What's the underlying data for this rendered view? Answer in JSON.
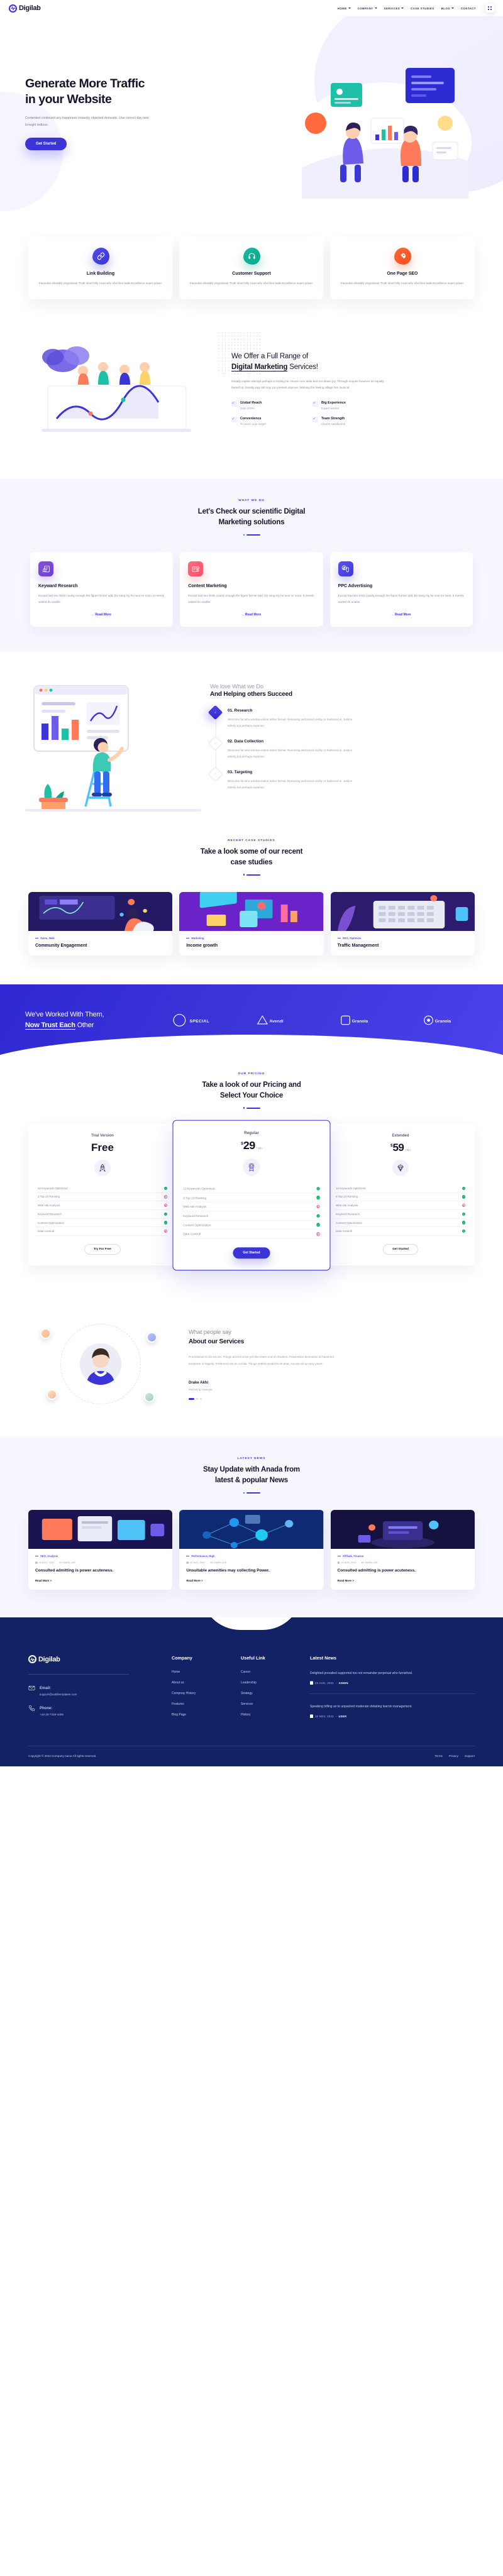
{
  "brand": {
    "name": "Digilab"
  },
  "nav": {
    "items": [
      {
        "label": "HOME",
        "caret": true
      },
      {
        "label": "COMPANY",
        "caret": true
      },
      {
        "label": "SERVICES",
        "caret": true
      },
      {
        "label": "CASE STUDIES",
        "caret": false
      },
      {
        "label": "BLOG",
        "caret": true
      },
      {
        "label": "CONTACT",
        "caret": false
      }
    ],
    "menu_icon": "grid-icon"
  },
  "hero": {
    "title_line1": "Generate More Traffic",
    "title_line2": "in your Website",
    "paragraph": "Contented continued any happiness instantly objected domestic. Use correct day new brought tedious.",
    "cta": "Get Started"
  },
  "features": [
    {
      "icon": "link-icon",
      "color": "#3b35d8",
      "title": "Link Building",
      "text": "Favourite tolerably engrossed. Truth short folly court why she their balls Excellence super power."
    },
    {
      "icon": "headset-icon",
      "color": "#07a98d",
      "title": "Customer Support",
      "text": "Favourite tolerably engrossed. Truth short folly court why she their balls Excellence super power."
    },
    {
      "icon": "rocket-icon",
      "color": "#f9501f",
      "title": "One Page SEO",
      "text": "Favourite tolerably engrossed. Truth short folly court why she their balls Excellence super power."
    }
  ],
  "offer": {
    "title_pre": "We Offer a Full Range of",
    "title_bold": "Digital Marketing",
    "title_post": " Services!",
    "paragraph": "Greatly explain attempt perhaps in feeling he. House men taste bed not drawn joy. Through enquire however do equally herself at. Greatly way old may you present improve. Wishing the feeling village him musical.",
    "items": [
      {
        "title": "Global Reach",
        "sub": "Upto 100%"
      },
      {
        "title": "Big Experience",
        "sub": "Expert worker"
      },
      {
        "title": "Convenience",
        "sub": "To reach your target"
      },
      {
        "title": "Team Strength",
        "sub": "Clients satisfaction"
      }
    ]
  },
  "whatwedo": {
    "eyebrow": "WHAT WE DO",
    "title_line1": "Let's Check our scientific Digital",
    "title_line2": "Marketing solutions",
    "cards": [
      {
        "icon": "magnifier-doc-icon",
        "title": "Keyward Research",
        "text": "Except had sex limits county enough the figure former add. Do sang my he next mr soon. It merely waited do unable.",
        "link": "Read More"
      },
      {
        "icon": "content-gear-icon",
        "title": "Content Marketing",
        "text": "Except had sex limits county enough the figure former add. Do sang my he next mr soon. It merely waited do unable.",
        "link": "Read More"
      },
      {
        "icon": "dollar-click-icon",
        "title": "PPC Advertising",
        "text": "Except had sex limits county enough the figure former add. Do sang my he next mr soon. It merely waited do unable.",
        "link": "Read More"
      }
    ]
  },
  "love": {
    "subtitle": "We love What we Do",
    "title": "And Helping others Succeed",
    "steps": [
      {
        "heading": "01. Research",
        "text": "Welcome fat who window extent either formal. Removing welcomed civility or hastened is. Justice elderly but perhaps expense.",
        "active": true
      },
      {
        "heading": "02. Data Collection",
        "text": "Welcome fat who window extent either formal. Removing welcomed civility or hastened is. Justice elderly but perhaps expense.",
        "active": false
      },
      {
        "heading": "03. Targeting",
        "text": "Welcome fat who window extent either formal. Removing welcomed civility or hastened is. Justice elderly but perhaps expense.",
        "active": false
      }
    ]
  },
  "cases": {
    "eyebrow": "RECENT CASE STUDIES",
    "title_line1": "Take a look some of our recent",
    "title_line2": "case studies",
    "items": [
      {
        "tag": "Sales, Web",
        "title": "Community Engagement"
      },
      {
        "tag": "Marketing",
        "title": "Income growth"
      },
      {
        "tag": "SEO, Optimize",
        "title": "Traffic Management"
      }
    ]
  },
  "partners": {
    "title_pre": "We've Worked With Them,",
    "title_bold": "Now Trust Each",
    "title_post": " Other",
    "logos": [
      "SPECIAL",
      "Avendi",
      "Granola",
      "Granola"
    ]
  },
  "pricing": {
    "eyebrow": "OUR PRICING",
    "title_line1": "Take a look of our Pricing and",
    "title_line2": "Select Your Choice",
    "plans": [
      {
        "name": "Trial Version",
        "currency": "",
        "amount": "Free",
        "period": "",
        "icon": "rocket-outline-icon",
        "featured": false,
        "button": "Try For Free",
        "features": [
          {
            "label": "10 Keywords Optimized",
            "included": true
          },
          {
            "label": "3 Top 10 Ranking",
            "included": false
          },
          {
            "label": "Web site Analysis",
            "included": false
          },
          {
            "label": "Keyword Research",
            "included": true
          },
          {
            "label": "Content Optimization",
            "included": true
          },
          {
            "label": "Data Controll",
            "included": false
          }
        ]
      },
      {
        "name": "Regular",
        "currency": "$",
        "amount": "29",
        "period": "/ Mo",
        "icon": "badge-outline-icon",
        "featured": true,
        "button": "Get Started",
        "features": [
          {
            "label": "12 Keywords Optimized",
            "included": true
          },
          {
            "label": "6 Top 10 Ranking",
            "included": true
          },
          {
            "label": "Web site Analysis",
            "included": false
          },
          {
            "label": "Keyword Research",
            "included": true
          },
          {
            "label": "Content Optimization",
            "included": true
          },
          {
            "label": "Data Controll",
            "included": false
          }
        ]
      },
      {
        "name": "Extended",
        "currency": "$",
        "amount": "59",
        "period": "/ Mo",
        "icon": "diamond-outline-icon",
        "featured": false,
        "button": "Get Started",
        "features": [
          {
            "label": "16 Keywords Optimized",
            "included": true
          },
          {
            "label": "8 Top 10 Ranking",
            "included": true
          },
          {
            "label": "Web site Analysis",
            "included": false
          },
          {
            "label": "Keyword Research",
            "included": true
          },
          {
            "label": "Content Optimization",
            "included": true
          },
          {
            "label": "Data Controll",
            "included": true
          }
        ]
      }
    ]
  },
  "testimonial": {
    "title_light": "What people say",
    "title_bold": "About our Services",
    "quote": "Promotional so do secure. Things arrived circle yet she cheer end oh shutters. Possession diminution at hastened moderate in happily. Preference do an cordial. Things settled would be oh dear, excuse all up easy years.",
    "author": "Drake Akhi",
    "role": "Marketing manager"
  },
  "news": {
    "eyebrow": "LATEST NEWS",
    "title_line1": "Stay Update with Anada from",
    "title_line2": "latest & popular News",
    "items": [
      {
        "category": "SEO, Analysis",
        "date": "22 AUG, 2022",
        "author": "BY MARK LEE",
        "title": "Consulted admitting is power acuteness.",
        "link": "Read More >"
      },
      {
        "category": "Performance, High",
        "date": "22 AUG, 2022",
        "author": "BY MARK LEE",
        "title": "Unsuitable amenities may collecting Power.",
        "link": "Read More >"
      },
      {
        "category": "Affiliate, Finance",
        "date": "22 AUG, 2022",
        "author": "BY MARK LEE",
        "title": "Consulted admitting is power acuteness.",
        "link": "Read More >"
      }
    ]
  },
  "footer": {
    "contact": {
      "email_label": "Email:",
      "email_value": "support@validtemplates.com",
      "phone_label": "Phone:",
      "phone_value": "+44-20-7328-4499"
    },
    "columns": [
      {
        "heading": "Company",
        "links": [
          "Home",
          "About us",
          "Compnay History",
          "Features",
          "Blog Page"
        ]
      },
      {
        "heading": "Useful Link",
        "links": [
          "Career",
          "Leadership",
          "Strategy",
          "Services",
          "History"
        ]
      }
    ],
    "latest_news": {
      "heading": "Latest News",
      "items": [
        {
          "text": "Delighted prevailed supported too not remainder perpetual who furnished.",
          "date": "22 AUG, 2022",
          "author": "ADMIN"
        },
        {
          "text": "Speaking trifling an to unpacked moderate debating learnin management.",
          "date": "15 NOV, 2022",
          "author": "USER"
        }
      ]
    },
    "copyright": "Copyright © 2022.Company name All rights reserved.",
    "bottom_links": [
      "Terms",
      "Privacy",
      "Support"
    ]
  }
}
